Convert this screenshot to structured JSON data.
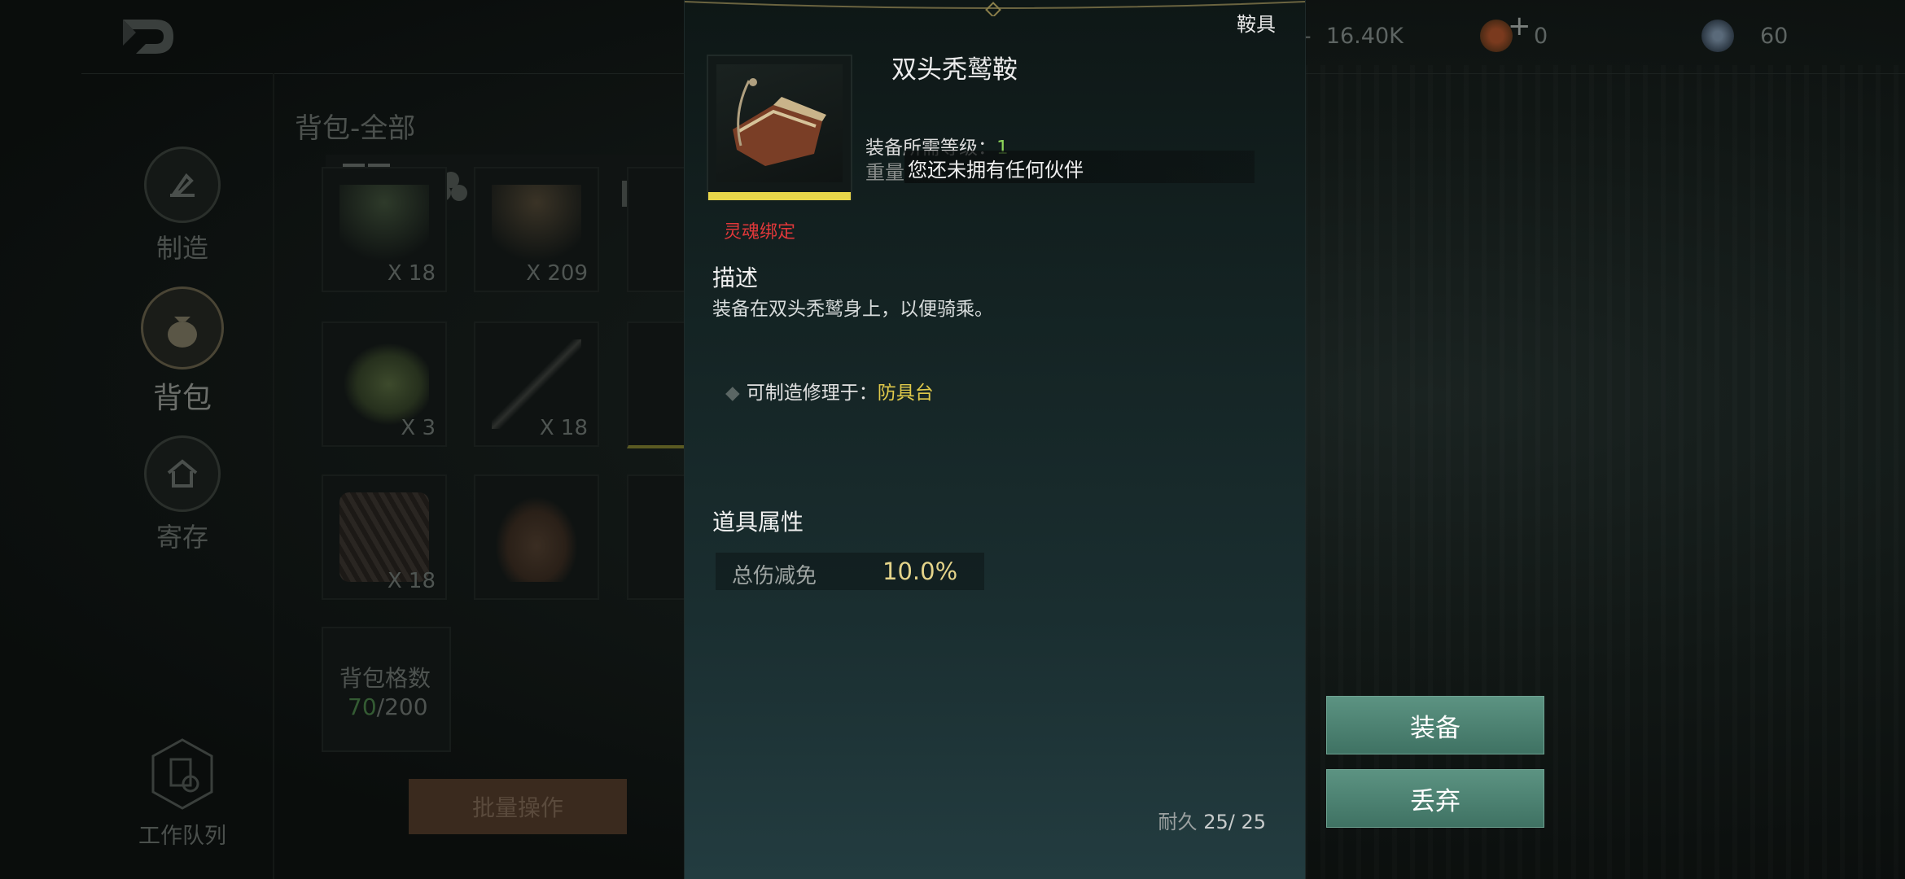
{
  "topbar": {
    "resources": [
      {
        "icon": "crystal-icon",
        "value": "16.40K"
      },
      {
        "icon": "coin-add-icon",
        "value": "0"
      },
      {
        "icon": "orb-icon",
        "value": "60"
      }
    ]
  },
  "sidebar": {
    "items": [
      {
        "label": "制造",
        "icon": "crafting-icon"
      },
      {
        "label": "背包",
        "icon": "bag-icon"
      },
      {
        "label": "寄存",
        "icon": "storage-icon"
      }
    ],
    "work_queue_label": "工作队列"
  },
  "inventory": {
    "title": "背包-全部",
    "tabs": [
      "all-grid-icon",
      "materials-icon",
      "weapons-icon",
      "consumables-icon"
    ],
    "slots": [
      {
        "qty": "X 18"
      },
      {
        "qty": "X 209"
      },
      {
        "qty": "X 3"
      },
      {
        "qty": "X 18"
      },
      {
        "qty": "X 18"
      },
      {
        "qty": ""
      }
    ],
    "capacity_label": "背包格数",
    "capacity_used": "70",
    "capacity_total": "/200",
    "batch_button": "批量操作"
  },
  "detail": {
    "category": "鞍具",
    "item_name": "双头秃鹫鞍",
    "requirement_label": "装备所需等级：",
    "requirement_value": "1",
    "weight_label": "重量",
    "toast": "您还未拥有任何伙伴",
    "bind_status": "灵魂绑定",
    "description_heading": "描述",
    "description": "装备在双头秃鹫身上，以便骑乘。",
    "craft_label": "可制造修理于：",
    "craft_station": "防具台",
    "attributes_heading": "道具属性",
    "attributes": [
      {
        "name": "总伤减免",
        "value": "10.0%"
      }
    ],
    "durability_label": "耐久",
    "durability_current": "25",
    "durability_max": "/ 25"
  },
  "actions": {
    "equip": "装备",
    "discard": "丢弃"
  },
  "colors": {
    "button": "#4f8473",
    "highlight_bar": "#e8d64a",
    "bind_red": "#e0383a",
    "station_yellow": "#e0c94a",
    "level_green": "#8ed65a"
  }
}
